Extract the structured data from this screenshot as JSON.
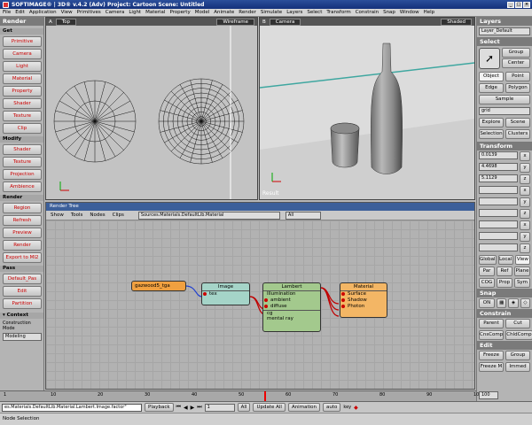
{
  "window": {
    "title": "SOFTIMAGE® | 3D® v.4.2 (Adv) Project: Cartoon   Scene: Untitled"
  },
  "menu": [
    "File",
    "Edit",
    "Application",
    "View",
    "Primitives",
    "Camera",
    "Light",
    "Material",
    "Property",
    "Model",
    "Animate",
    "Render",
    "Simulate",
    "Layers",
    "Select",
    "Transform",
    "Constrain",
    "Snap",
    "Window",
    "Help"
  ],
  "left_panel": {
    "header": "Render",
    "sections": [
      {
        "title": "Get",
        "items": [
          "Primitive",
          "Camera",
          "Light",
          "Material",
          "Property",
          "Shader",
          "Texture",
          "Clip"
        ]
      },
      {
        "title": "Modify",
        "items": [
          "Shader",
          "Texture",
          "Projection",
          "Ambience"
        ]
      },
      {
        "title": "Render",
        "items": [
          "Region",
          "Refresh",
          "Preview",
          "Render",
          "Export to MI2"
        ]
      },
      {
        "title": "Pass",
        "items": [
          "Default_Pas",
          "Edit",
          "Partition"
        ]
      }
    ],
    "context_title": "▾ Context",
    "construction_mode_label": "Construction Mode",
    "construction_mode_value": "Modeling"
  },
  "viewport_top": {
    "view_name": "Top",
    "mode": "Wireframe"
  },
  "viewport_camera": {
    "view_name": "Camera",
    "mode": "Shaded",
    "result_label": "Result"
  },
  "right_panel": {
    "layers_header": "Layers",
    "layer_value": "Layer_Default",
    "select_header": "Select",
    "select_buttons": [
      "Group",
      "Center",
      "Object",
      "Point",
      "Edge",
      "Polygon",
      "Sample"
    ],
    "filter_value": "grid",
    "select_row3": [
      "Explore",
      "Scene",
      "Selection",
      "Clusters"
    ],
    "transform_header": "Transform",
    "transform_values": [
      "0.0139",
      "4.4698",
      "5.1129"
    ],
    "transform_axes": [
      "x",
      "y",
      "z"
    ],
    "transform_rows_sr": [
      "x",
      "y",
      "z",
      "x",
      "y",
      "z"
    ],
    "transform_modes": [
      "Global",
      "Local",
      "View",
      "Par",
      "Ref",
      "Plane"
    ],
    "cog_row": [
      "COG",
      "Prop",
      "Sym"
    ],
    "snap_header": "Snap",
    "snap_on": "ON",
    "constrain_header": "Constrain",
    "constrain_buttons": [
      "Parent",
      "Cut",
      "CnsComp",
      "ChldComp"
    ],
    "edit_header": "Edit",
    "edit_buttons": [
      "Freeze",
      "Group",
      "Freeze M",
      "Immed"
    ]
  },
  "render_tree": {
    "title": "Render Tree",
    "toolbar": [
      "Show",
      "Tools",
      "Nodes",
      "Clips"
    ],
    "path": "Sources.Materials.DefaultLib.Material",
    "filter": "All",
    "nodes": {
      "texture": {
        "label": "gazwood5_tga"
      },
      "image": {
        "label": "Image",
        "ports": [
          "tex"
        ]
      },
      "lambert": {
        "label": "Lambert",
        "group": "Illumination",
        "ports": [
          "ambient",
          "diffuse"
        ],
        "extras": [
          "cg",
          "mental ray"
        ]
      },
      "material": {
        "label": "Material",
        "ports": [
          "Surface",
          "Shadow",
          "Photon"
        ]
      }
    }
  },
  "timeline": {
    "ticks": [
      "1",
      "10",
      "20",
      "30",
      "40",
      "50",
      "60",
      "70",
      "80",
      "90",
      "100"
    ],
    "end_value": "100",
    "playhead_frame": 56
  },
  "playbar": {
    "command_text": "es.Materials.DefaultLib.Material.Lambert.Image.factor\"",
    "playback_label": "Playback",
    "frame_value": "1",
    "all_label": "All",
    "update_label": "Update All",
    "animation_label": "Animation",
    "auto_label": "auto",
    "key_label": "key"
  },
  "status": {
    "text": "Node Selection"
  },
  "colors": {
    "texture_node": "#f0a040",
    "image_node": "#a5d4c8",
    "lambert_node": "#a3c98d",
    "material_node": "#f3b665",
    "link": "#c00000",
    "link_blue": "#2040d0",
    "header_blue": "#3c5f9a"
  }
}
